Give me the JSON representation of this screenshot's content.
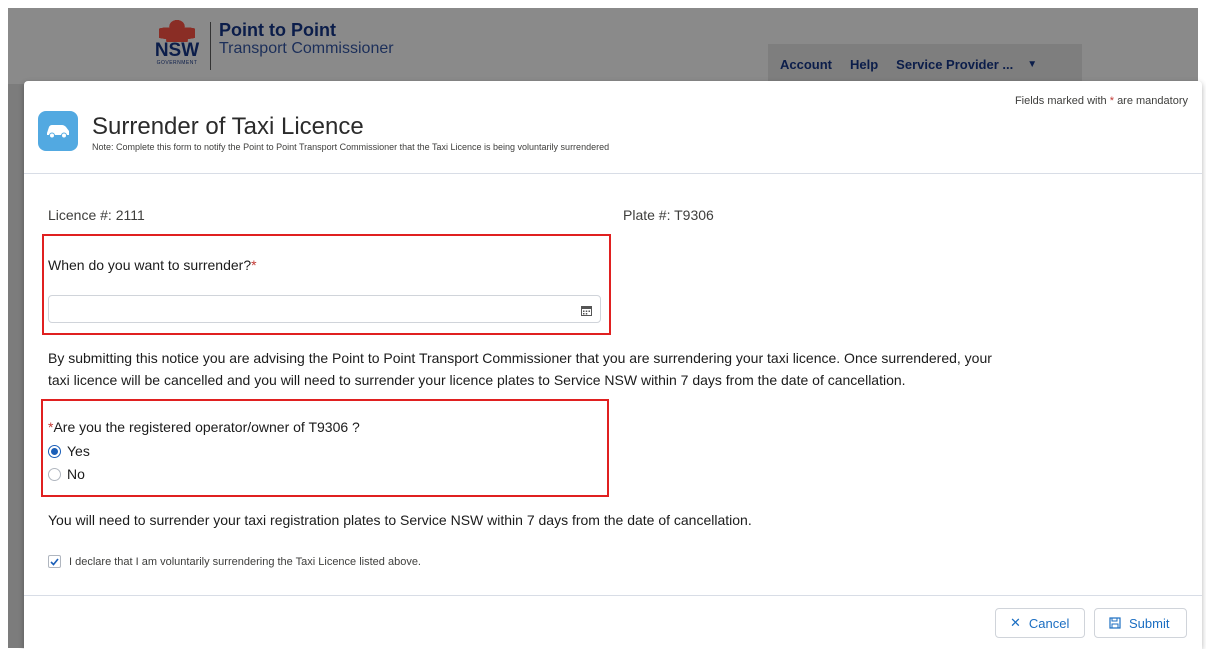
{
  "background": {
    "logo": {
      "nsw": "NSW",
      "government": "GOVERNMENT",
      "title": "Point to Point",
      "subtitle": "Transport Commissioner"
    },
    "nav": {
      "account": "Account",
      "help": "Help",
      "service_provider": "Service Provider ..."
    }
  },
  "modal": {
    "mandatory_prefix": "Fields marked with",
    "mandatory_star": "*",
    "mandatory_suffix": "are mandatory",
    "icon": "car-icon",
    "title": "Surrender of Taxi Licence",
    "note": "Note: Complete this form to notify the Point to Point Transport Commissioner that the Taxi Licence is being voluntarily surrendered",
    "licence": "Licence #:  2111",
    "plate": "Plate #:  T9306",
    "surrender_question": "When do you want to surrender?",
    "required_star": "*",
    "date_value": "",
    "calendar_icon": "calendar-icon",
    "notice_line1": "By submitting this notice you are advising the Point to Point Transport Commissioner that you are surrendering your taxi licence. Once surrendered, your",
    "notice_line2": "taxi licence will be cancelled and you will need to surrender your licence plates to Service NSW within 7 days from the date of cancellation.",
    "operator_question": "Are you the registered operator/owner of T9306 ?",
    "options": [
      {
        "label": "Yes",
        "checked": true
      },
      {
        "label": "No",
        "checked": false
      }
    ],
    "plates_notice": "You will need to surrender your taxi registration plates to Service NSW within 7 days from the date of cancellation.",
    "declaration": "I declare that I am voluntarily surrendering the Taxi Licence listed above.",
    "declaration_checked": true,
    "cancel_label": "Cancel",
    "submit_label": "Submit"
  },
  "colors": {
    "accent": "#1b6ec2",
    "highlight": "#e02020",
    "icon_bg": "#52a9e1",
    "required": "#c23934"
  }
}
